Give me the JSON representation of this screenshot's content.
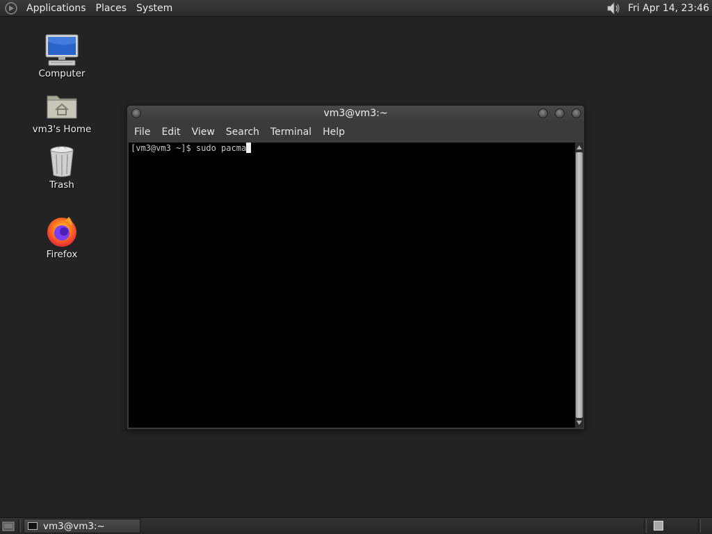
{
  "top_panel": {
    "menus": [
      "Applications",
      "Places",
      "System"
    ],
    "clock": "Fri Apr 14, 23:46",
    "logo_icon": "gnome-foot-icon",
    "volume_icon": "speaker-icon"
  },
  "desktop": {
    "icons": [
      {
        "label": "Computer",
        "icon": "computer-icon"
      },
      {
        "label": "vm3's Home",
        "icon": "home-folder-icon"
      },
      {
        "label": "Trash",
        "icon": "trash-icon"
      },
      {
        "label": "Firefox",
        "icon": "firefox-icon"
      }
    ]
  },
  "terminal": {
    "title": "vm3@vm3:~",
    "menus": [
      "File",
      "Edit",
      "View",
      "Search",
      "Terminal",
      "Help"
    ],
    "prompt": "[vm3@vm3 ~]$ ",
    "input": "sudo pacma",
    "colors": {
      "background": "#000000",
      "text": "#c8c8c8"
    }
  },
  "taskbar": {
    "window_button": "vm3@vm3:~"
  }
}
